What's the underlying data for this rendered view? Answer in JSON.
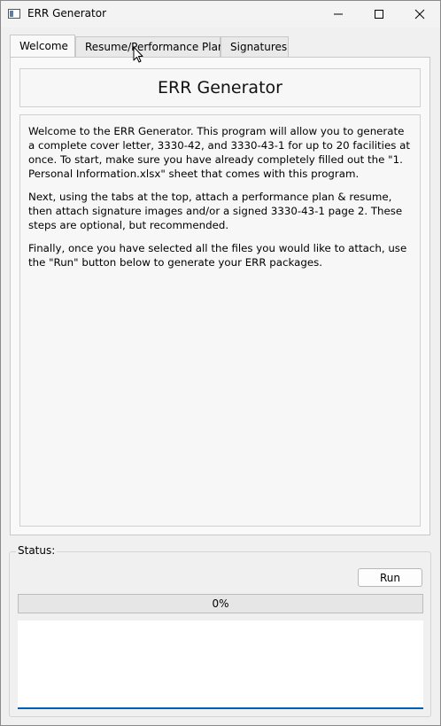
{
  "window": {
    "title": "ERR Generator"
  },
  "tabs": [
    {
      "label": "Welcome",
      "active": true
    },
    {
      "label": "Resume/Performance Plan",
      "active": false
    },
    {
      "label": "Signatures",
      "active": false
    }
  ],
  "welcome": {
    "heading": "ERR Generator",
    "paragraphs": [
      "Welcome to the ERR Generator. This program will allow you to generate a complete cover letter, 3330-42, and 3330-43-1 for up to 20 facilities at once. To start, make sure you have already completely filled out the \"1. Personal Information.xlsx\" sheet that comes with this program.",
      "Next, using the tabs at the top, attach a performance plan & resume, then attach signature images and/or a signed 3330-43-1 page 2. These steps are optional, but recommended.",
      "Finally, once you have selected all the files you would like to attach, use the \"Run\" button below to generate your ERR packages."
    ]
  },
  "status": {
    "label": "Status:",
    "run_label": "Run",
    "progress_value": 0,
    "progress_text": "0%",
    "log": ""
  },
  "icons": {
    "app": "window-app-icon",
    "minimize": "minimize-icon",
    "maximize": "maximize-icon",
    "close": "close-icon",
    "cursor": "mouse-pointer-icon"
  },
  "colors": {
    "accent": "#005fb8",
    "progress": "#06b025"
  }
}
